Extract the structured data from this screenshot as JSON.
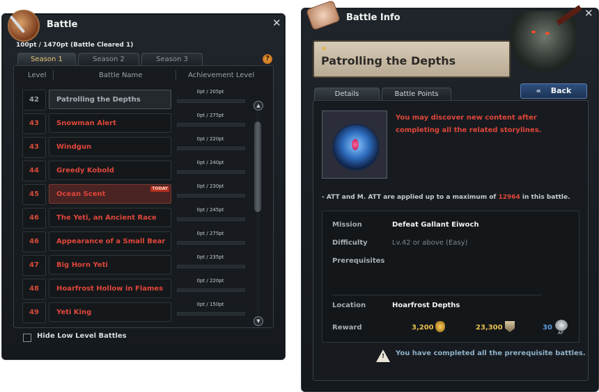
{
  "battle": {
    "title": "Battle",
    "points_main": "100pt / 1470pt",
    "points_note": "(Battle Cleared 1)",
    "tabs": [
      "Season 1",
      "Season 2",
      "Season 3"
    ],
    "help": "?",
    "columns": {
      "level": "Level",
      "name": "Battle Name",
      "achievement": "Achievement Level"
    },
    "rows": [
      {
        "level": "42",
        "name": "Patrolling the Depths",
        "ach": "0pt / 205pt",
        "state": "current"
      },
      {
        "level": "43",
        "name": "Snowman Alert",
        "ach": "0pt / 275pt",
        "state": ""
      },
      {
        "level": "43",
        "name": "Windgun",
        "ach": "0pt / 220pt",
        "state": ""
      },
      {
        "level": "44",
        "name": "Greedy Kobold",
        "ach": "0pt / 240pt",
        "state": ""
      },
      {
        "level": "45",
        "name": "Ocean Scent",
        "ach": "0pt / 230pt",
        "state": "today"
      },
      {
        "level": "46",
        "name": "The Yeti, an Ancient Race",
        "ach": "0pt / 245pt",
        "state": ""
      },
      {
        "level": "46",
        "name": "Appearance of a Small Bear",
        "ach": "0pt / 275pt",
        "state": ""
      },
      {
        "level": "47",
        "name": "Big Horn Yeti",
        "ach": "0pt / 235pt",
        "state": ""
      },
      {
        "level": "48",
        "name": "Hoarfrost Hollow in Flames",
        "ach": "0pt / 220pt",
        "state": ""
      },
      {
        "level": "49",
        "name": "Yeti King",
        "ach": "0pt / 150pt",
        "state": ""
      }
    ],
    "today_badge": "TODAY",
    "hide_low_label": "Hide Low Level Battles",
    "close": "✕"
  },
  "info": {
    "title": "Battle Info",
    "battle_name": "Patrolling the Depths",
    "back_label": "Back",
    "back_chevron": "«",
    "tabs": [
      "Details",
      "Battle Points"
    ],
    "message": "You may discover new content after completing all the related storylines.",
    "att_pre": "- ATT and M. ATT are applied up to a maximum of",
    "att_value": "12964",
    "att_post": "in this battle.",
    "labels": {
      "mission": "Mission",
      "difficulty": "Difficulty",
      "prereq": "Prerequisites",
      "location": "Location",
      "reward": "Reward"
    },
    "mission": "Defeat Gallant Eiwoch",
    "difficulty": "Lv.42 or above (Easy)",
    "location": "Hoarfrost Depths",
    "reward_gold": "3,200",
    "reward_points": "23,300",
    "reward_ap": "30",
    "ap_text": "AP",
    "complete_msg": "You have completed all the prerequisite battles.",
    "close": "✕"
  },
  "colors": {
    "accent_red": "#e0463a",
    "gold": "#e7c04e",
    "blue": "#5b9ce0"
  }
}
